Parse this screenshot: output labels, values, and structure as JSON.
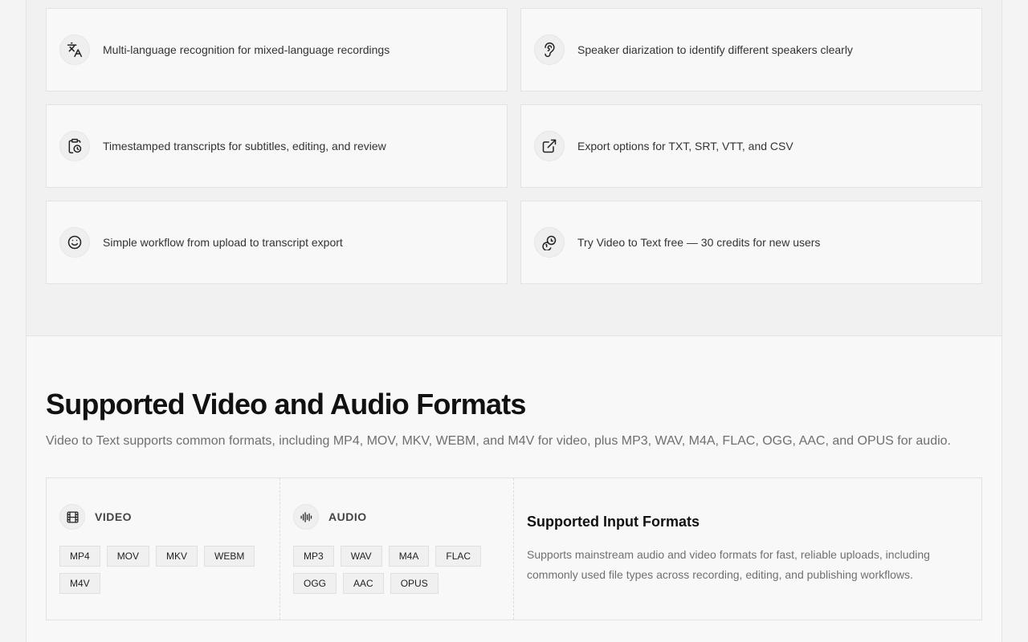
{
  "features": [
    {
      "icon": "translate-icon",
      "text": "Multi-language recognition for mixed-language recordings"
    },
    {
      "icon": "speaker-icon",
      "text": "Speaker diarization to identify different speakers clearly"
    },
    {
      "icon": "clipboard-clock-icon",
      "text": "Timestamped transcripts for subtitles, editing, and review"
    },
    {
      "icon": "external-link-icon",
      "text": "Export options for TXT, SRT, VTT, and CSV"
    },
    {
      "icon": "smile-icon",
      "text": "Simple workflow from upload to transcript export"
    },
    {
      "icon": "coins-icon",
      "text": "Try Video to Text free — 30 credits for new users"
    }
  ],
  "formats": {
    "title": "Supported Video and Audio Formats",
    "subtitle": "Video to Text supports common formats, including MP4, MOV, MKV, WEBM, and M4V for video, plus MP3, WAV, M4A, FLAC, OGG, AAC, and OPUS for audio.",
    "video": {
      "label": "VIDEO",
      "icon": "film-icon",
      "tags": [
        "MP4",
        "MOV",
        "MKV",
        "WEBM",
        "M4V"
      ]
    },
    "audio": {
      "label": "AUDIO",
      "icon": "audio-waveform-icon",
      "tags": [
        "MP3",
        "WAV",
        "M4A",
        "FLAC",
        "OGG",
        "AAC",
        "OPUS"
      ]
    },
    "info": {
      "title": "Supported Input Formats",
      "text": "Supports mainstream audio and video formats for fast, reliable uploads, including commonly used file types across recording, editing, and publishing workflows."
    }
  },
  "colors": {
    "page_bg": "#f4f4f4",
    "section_bg": "#f1f1f1",
    "card_bg": "#f8f8f8",
    "title": "#111111",
    "muted": "#6f6f6f"
  }
}
